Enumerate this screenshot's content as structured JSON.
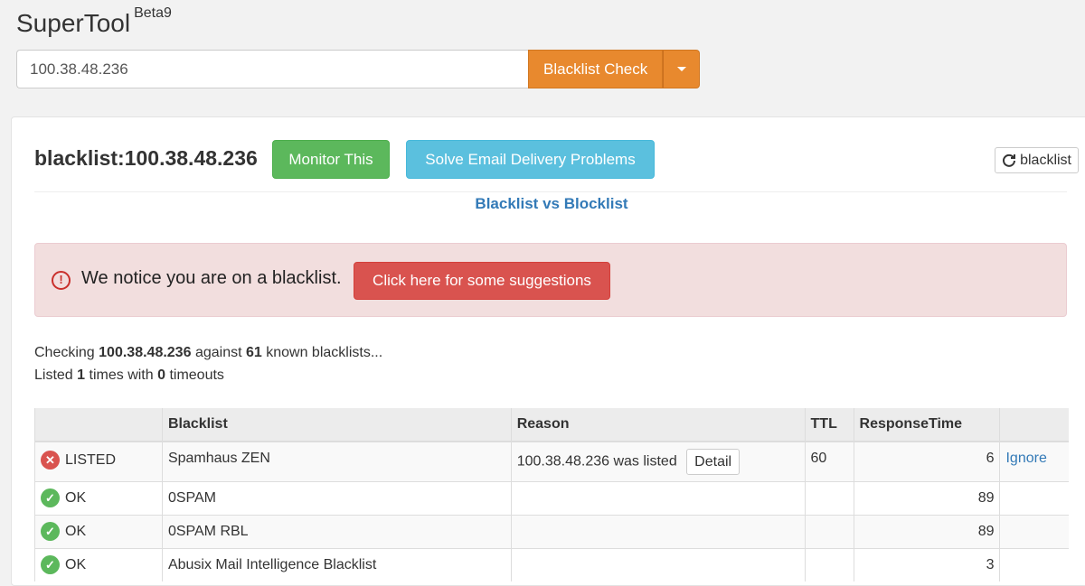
{
  "header": {
    "title": "SuperTool",
    "badge": "Beta9",
    "search_value": "100.38.48.236",
    "check_button": "Blacklist Check"
  },
  "panel": {
    "heading": "blacklist:100.38.48.236",
    "monitor_button": "Monitor This",
    "solve_button": "Solve Email Delivery Problems",
    "refresh_button": "blacklist",
    "vs_link": "Blacklist vs Blocklist"
  },
  "alert": {
    "text": "We notice you are on a blacklist.",
    "button": "Click here for some suggestions"
  },
  "summary": {
    "checking_prefix": "Checking",
    "ip": "100.38.48.236",
    "against": "against",
    "count": "61",
    "known": "known blacklists...",
    "listed_prefix": "Listed",
    "listed_count": "1",
    "times_with": "times with",
    "timeouts_count": "0",
    "timeouts": "timeouts"
  },
  "table": {
    "headers": [
      "",
      "Blacklist",
      "Reason",
      "TTL",
      "ResponseTime",
      ""
    ],
    "rows": [
      {
        "status": "LISTED",
        "blacklist": "Spamhaus ZEN",
        "reason": "100.38.48.236 was listed",
        "detail": "Detail",
        "ttl": "60",
        "response": "6",
        "action": "Ignore"
      },
      {
        "status": "OK",
        "blacklist": "0SPAM",
        "reason": "",
        "ttl": "",
        "response": "89",
        "action": ""
      },
      {
        "status": "OK",
        "blacklist": "0SPAM RBL",
        "reason": "",
        "ttl": "",
        "response": "89",
        "action": ""
      },
      {
        "status": "OK",
        "blacklist": "Abusix Mail Intelligence Blacklist",
        "reason": "",
        "ttl": "",
        "response": "3",
        "action": ""
      }
    ]
  },
  "colors": {
    "accent_orange": "#e8892e",
    "success": "#5cb85c",
    "info": "#5bc0de",
    "danger": "#d9534f",
    "link": "#337ab7"
  }
}
